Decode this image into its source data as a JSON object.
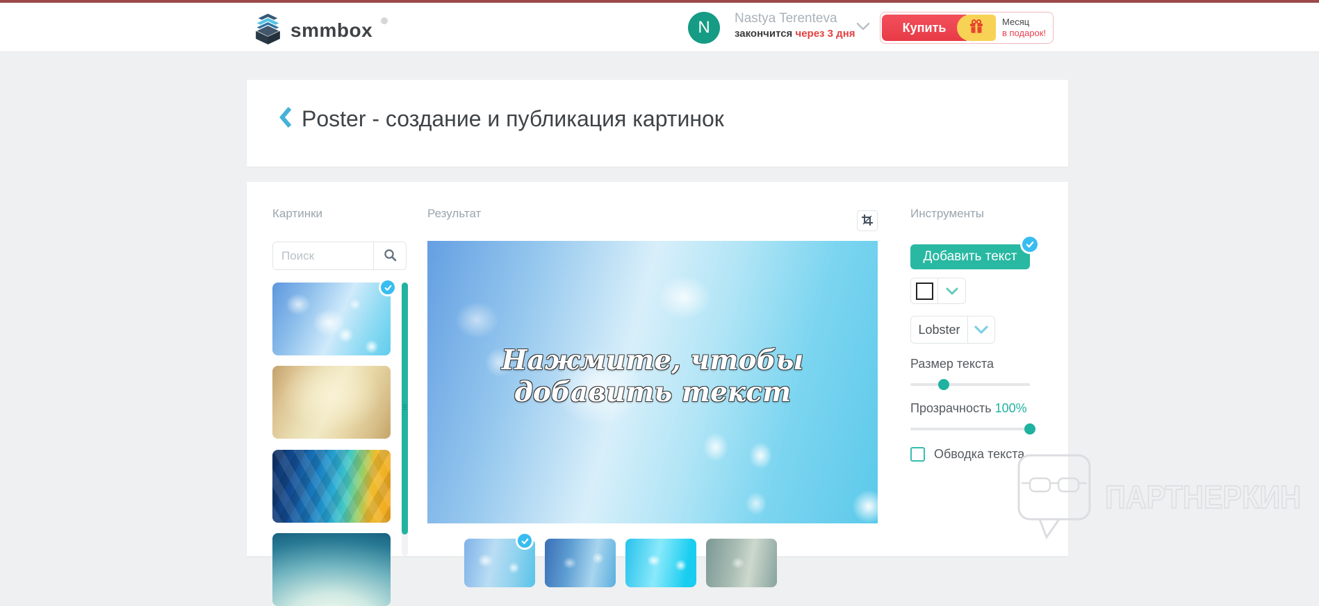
{
  "colors": {
    "top_line": "#9c4a4a",
    "accent_teal": "#29b8a2",
    "badge_blue": "#38bdf0",
    "buy_red": "#ef4352",
    "promo_yellow": "#f8d254",
    "danger_red": "#e23f3f"
  },
  "header": {
    "logo_text": "smmbox",
    "user": {
      "initial": "N",
      "name": "Nastya Terenteva",
      "subscription_prefix": "закончится",
      "subscription_highlight": "через 3 дня"
    },
    "buy": {
      "label": "Купить",
      "promo_line1": "Месяц",
      "promo_line2": "в подарок!"
    }
  },
  "page": {
    "title": "Poster - создание и публикация картинок"
  },
  "images_panel": {
    "title": "Картинки",
    "search_placeholder": "Поиск",
    "thumbnails": [
      {
        "name": "blue-bokeh",
        "style": "thumb-bokeh-blue",
        "selected": true
      },
      {
        "name": "old-paper",
        "style": "thumb-paper",
        "selected": false
      },
      {
        "name": "geometric-triangles",
        "style": "thumb-geo",
        "selected": false
      },
      {
        "name": "teal-gradient",
        "style": "thumb-teal",
        "selected": false
      }
    ]
  },
  "result_panel": {
    "title": "Результат",
    "overlay_text": "Нажмите, чтобы добавить текст",
    "variants": [
      {
        "name": "blue-bokeh",
        "style": "variant-1",
        "selected": true
      },
      {
        "name": "deep-blue-bokeh",
        "style": "variant-2",
        "selected": false
      },
      {
        "name": "bright-cyan-bokeh",
        "style": "variant-3",
        "selected": false
      },
      {
        "name": "gray-teal-bokeh",
        "style": "variant-4",
        "selected": false
      }
    ]
  },
  "tools_panel": {
    "title": "Инструменты",
    "add_text_label": "Добавить текст",
    "font_name": "Lobster",
    "text_size_label": "Размер текста",
    "text_size_percent": 28,
    "opacity_label": "Прозрачность",
    "opacity_value": "100%",
    "opacity_percent": 100,
    "outline_label": "Обводка текста",
    "outline_checked": false
  },
  "watermark": {
    "text": "ПАРТНЕРКИН"
  }
}
